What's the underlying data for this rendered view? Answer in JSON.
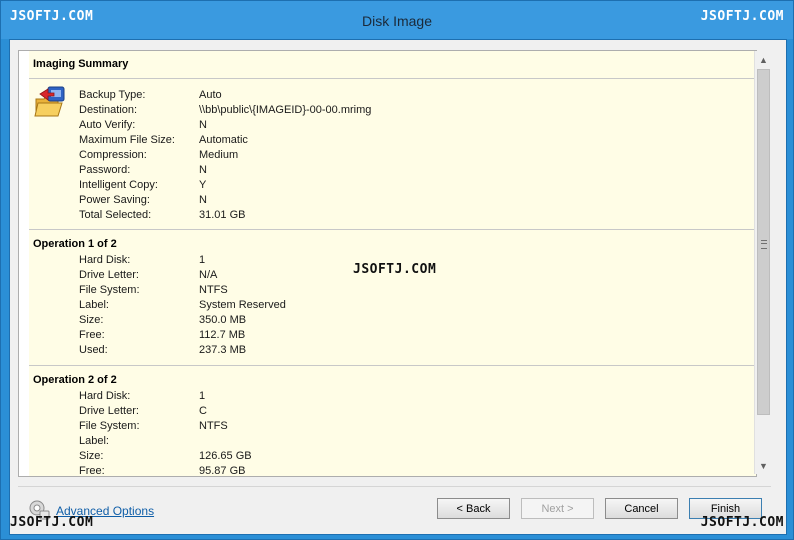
{
  "window": {
    "title": "Disk Image"
  },
  "watermark": {
    "text": "JSOFTJ.COM"
  },
  "summary": {
    "title": "Imaging Summary",
    "icon": "backup-folder-icon",
    "rows": [
      {
        "key": "Backup Type:",
        "value": "Auto"
      },
      {
        "key": "Destination:",
        "value": "\\\\bb\\public\\{IMAGEID}-00-00.mrimg"
      },
      {
        "key": "Auto Verify:",
        "value": "N"
      },
      {
        "key": "Maximum File Size:",
        "value": "Automatic"
      },
      {
        "key": "Compression:",
        "value": "Medium"
      },
      {
        "key": "Password:",
        "value": "N"
      },
      {
        "key": "Intelligent Copy:",
        "value": "Y"
      },
      {
        "key": "Power Saving:",
        "value": "N"
      },
      {
        "key": "Total Selected:",
        "value": "31.01 GB"
      }
    ]
  },
  "operations": [
    {
      "title": "Operation 1 of 2",
      "rows": [
        {
          "key": "Hard Disk:",
          "value": "1"
        },
        {
          "key": "Drive Letter:",
          "value": "N/A"
        },
        {
          "key": "File System:",
          "value": "NTFS"
        },
        {
          "key": "Label:",
          "value": "System Reserved"
        },
        {
          "key": "Size:",
          "value": "350.0 MB"
        },
        {
          "key": "Free:",
          "value": "112.7 MB"
        },
        {
          "key": "Used:",
          "value": "237.3 MB"
        }
      ]
    },
    {
      "title": "Operation 2 of 2",
      "rows": [
        {
          "key": "Hard Disk:",
          "value": "1"
        },
        {
          "key": "Drive Letter:",
          "value": "C"
        },
        {
          "key": "File System:",
          "value": "NTFS"
        },
        {
          "key": "Label:",
          "value": ""
        },
        {
          "key": "Size:",
          "value": "126.65 GB"
        },
        {
          "key": "Free:",
          "value": "95.87 GB"
        }
      ]
    }
  ],
  "footer": {
    "advanced_options": "Advanced Options",
    "back": "< Back",
    "next": "Next >",
    "cancel": "Cancel",
    "finish": "Finish"
  }
}
